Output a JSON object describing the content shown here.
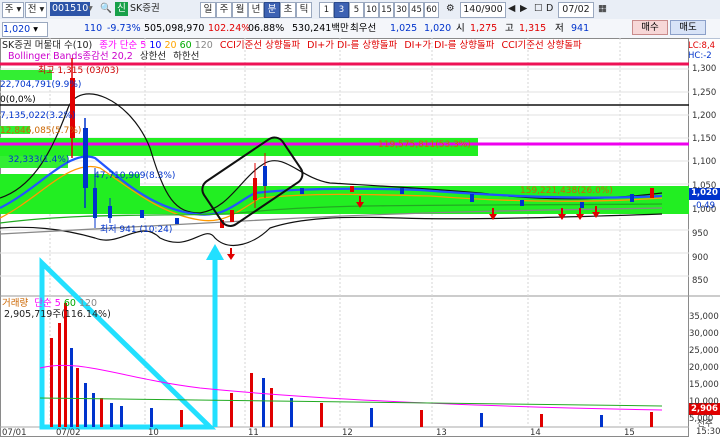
{
  "toolbar": {
    "type_label": "주",
    "period_label": "전",
    "code": "001510",
    "credit_badge": "신",
    "stock_name": "SK증권",
    "periods": [
      "일",
      "주",
      "월",
      "년",
      "분",
      "초",
      "틱"
    ],
    "selected_period": "분",
    "minutes": [
      "1",
      "3",
      "5",
      "10",
      "15",
      "30",
      "45",
      "60"
    ],
    "selected_minute": "3",
    "count": "140/900",
    "date_flag": "D",
    "date": "07/02"
  },
  "quote": {
    "price": "1,020",
    "change": "110",
    "change_pct": "-9.73%",
    "volume": "505,098,970",
    "volume_ratio": "102.24%",
    "turnover": "06.88%",
    "amount": "530,241백만",
    "pref_label": "최우선",
    "best_bid": "1,025",
    "best_ask": "1,020",
    "open_label": "시",
    "open": "1,275",
    "high_label": "고",
    "high": "1,315",
    "low_label": "저",
    "low": "941",
    "buy_label": "매수",
    "sell_label": "매도"
  },
  "price_legend": {
    "name": "SK증권 머물대 수(10)",
    "ma_label": "종가 단순",
    "ma_periods": [
      "5",
      "10",
      "20",
      "60",
      "120"
    ],
    "ma_colors": [
      "#ff00ff",
      "#0000ff",
      "#ffa500",
      "#00aa00",
      "#888888"
    ],
    "cci_1": "CCI기준선 상향돌파",
    "di_1": "DI+가 DI-를 상향돌파",
    "di_2": "DI+가 DI-를 상향돌파",
    "cci_2": "CCI기준선 상향돌파",
    "bollinger": "Bollinger Bands종감선 20,2",
    "upper_limit": "상한선",
    "lower_limit": "하한선",
    "right_top": "LC:8,4",
    "right_hc": "HC:-2"
  },
  "price_annotations": {
    "high_label": "최고 1,315 (03/03)",
    "vp_1": "22,704,791(9.9%)",
    "vp_2": "0(0,0%)",
    "vp_3": "7,135,022(3.2%)",
    "vp_4": "12,846,085(5.7%)",
    "vp_5": "32,333(1.4%)",
    "vp_6": "47,710,909(8.3%)",
    "vp_7": "119,575,811(53.3%)",
    "vp_8": "159,221,438(26.0%)",
    "low_label": "최저 941 (10:24)"
  },
  "price_axis": [
    "1,300",
    "1,250",
    "1,200",
    "1,150",
    "1,100",
    "1,050",
    "1,000",
    "950",
    "900",
    "850"
  ],
  "price_current": "1,020",
  "price_current_pct": "-0.49",
  "volume_legend": {
    "name": "거래량",
    "ma_label": "단순",
    "ma_periods": [
      "5",
      "60",
      "120"
    ],
    "ma_colors": [
      "#ff00ff",
      "#00aa00",
      "#888888"
    ],
    "value": "2,905,719주(116.14%)"
  },
  "volume_axis": [
    "35,000",
    "30,000",
    "25,000",
    "20,000",
    "15,000",
    "10,000",
    "5,000"
  ],
  "volume_current": "2,906",
  "volume_unit": "천주",
  "time_axis": [
    "07/01",
    "07/02",
    "10",
    "11",
    "12",
    "13",
    "14",
    "15"
  ],
  "time_end": "15:30"
}
